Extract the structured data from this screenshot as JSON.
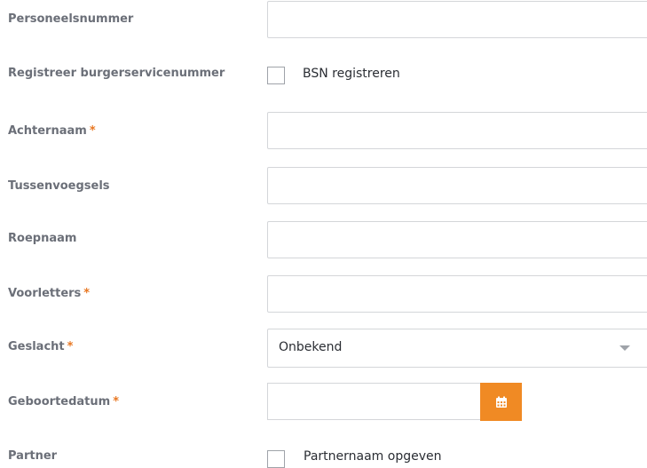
{
  "fields": {
    "personeelsnummer": {
      "label": "Personeelsnummer",
      "value": ""
    },
    "bsn": {
      "label": "Registreer burgerservicenummer",
      "checkbox_label": "BSN registreren",
      "checked": false
    },
    "achternaam": {
      "label": "Achternaam",
      "required_mark": "*",
      "value": ""
    },
    "tussenvoegsels": {
      "label": "Tussenvoegsels",
      "value": ""
    },
    "roepnaam": {
      "label": "Roepnaam",
      "value": ""
    },
    "voorletters": {
      "label": "Voorletters",
      "required_mark": "*",
      "value": ""
    },
    "geslacht": {
      "label": "Geslacht",
      "required_mark": "*",
      "selected": "Onbekend"
    },
    "geboortedatum": {
      "label": "Geboortedatum",
      "required_mark": "*",
      "value": ""
    },
    "partner": {
      "label": "Partner",
      "checkbox_label": "Partnernaam opgeven",
      "checked": false
    }
  },
  "icons": {
    "calendar": "calendar-icon",
    "dropdown": "chevron-down-icon"
  },
  "colors": {
    "accent": "#f08a24",
    "required": "#e87722",
    "label": "#6b6f78"
  }
}
